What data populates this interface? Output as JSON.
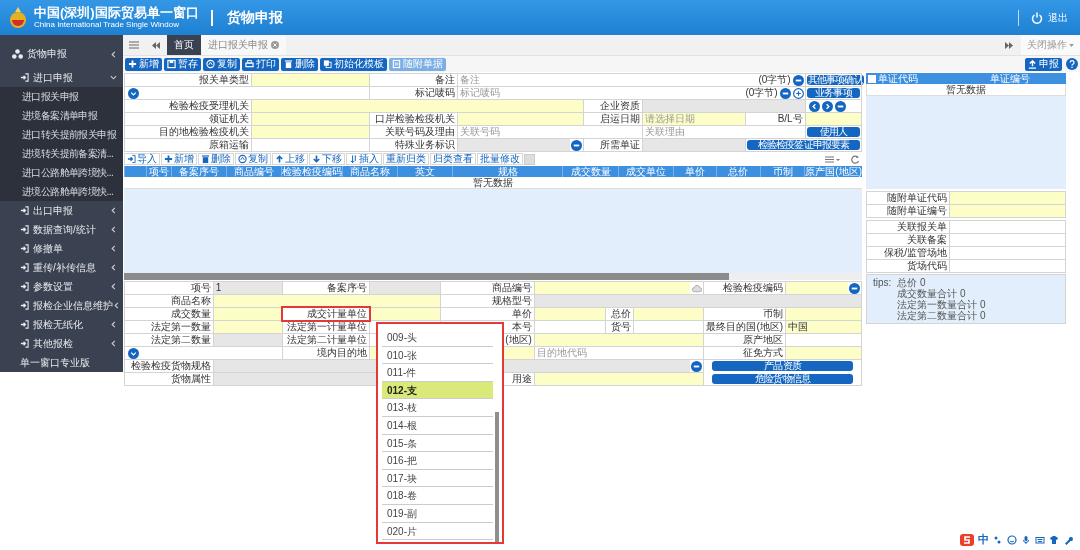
{
  "header": {
    "title": "中国(深圳)国际贸易单一窗口",
    "subtitle": "China International Trade Single Window",
    "section": "货物申报",
    "logout": "退出"
  },
  "sidebar": {
    "items": [
      {
        "label": "货物申报",
        "children": [
          {
            "label": "进口申报",
            "expanded": true,
            "children": [
              {
                "label": "进口报关申报"
              },
              {
                "label": "进境备案清单申报"
              },
              {
                "label": "进口转关提前报关申报"
              },
              {
                "label": "进境转关提前备案清..."
              },
              {
                "label": "进口公路舱单跨境快..."
              },
              {
                "label": "进境公路舱单跨境快..."
              }
            ]
          },
          {
            "label": "出口申报",
            "expanded": false
          },
          {
            "label": "数据查询/统计",
            "expanded": false
          },
          {
            "label": "修撤单",
            "expanded": false
          },
          {
            "label": "重传/补传信息",
            "expanded": false
          },
          {
            "label": "参数设置",
            "expanded": false
          },
          {
            "label": "报检企业信息维护",
            "expanded": false
          },
          {
            "label": "报检无纸化",
            "expanded": false
          },
          {
            "label": "其他报检",
            "expanded": false
          }
        ]
      },
      {
        "label": "单一窗口专业版"
      }
    ]
  },
  "tabs": [
    {
      "label": "首页",
      "selected": true,
      "closable": false
    },
    {
      "label": "进口报关申报",
      "selected": false,
      "closable": true
    }
  ],
  "close_menu": "关闭操作",
  "toolbar": {
    "buttons": [
      {
        "label": "新增",
        "disabled": false
      },
      {
        "label": "暂存",
        "disabled": false
      },
      {
        "label": "复制",
        "disabled": false
      },
      {
        "label": "打印",
        "disabled": false
      },
      {
        "label": "删除",
        "disabled": false
      },
      {
        "label": "初始化模板",
        "disabled": false
      },
      {
        "label": "随附单据",
        "disabled": true
      }
    ],
    "submit": "申报"
  },
  "top_form": {
    "rows": [
      [
        {
          "kind": "label",
          "text": "报关单类型"
        },
        {
          "kind": "required_field"
        },
        {
          "kind": "label",
          "text": "备注"
        },
        {
          "kind": "field",
          "placeholder": "备注",
          "suffix": "(0字节)",
          "controls": [
            {
              "kind": "remove"
            }
          ]
        },
        "",
        "",
        "",
        {
          "kind": "button",
          "text": "其他事项确认"
        }
      ],
      [
        {
          "kind": "controls",
          "controls": [
            {
              "kind": "expand"
            }
          ]
        },
        "",
        {
          "kind": "label",
          "text": "标记唛码"
        },
        {
          "kind": "field",
          "placeholder": "标记唛码",
          "suffix": "(0字节)",
          "controls": [
            {
              "kind": "remove"
            },
            {
              "kind": "add"
            }
          ]
        },
        "",
        "",
        "",
        {
          "kind": "button",
          "text": "业务事项"
        }
      ],
      [
        {
          "kind": "label",
          "text": "检验检疫受理机关"
        },
        {
          "kind": "required_field"
        },
        "",
        "",
        {
          "kind": "label",
          "text": "企业资质"
        },
        {
          "kind": "readonly_field"
        },
        "",
        {
          "kind": "controls",
          "controls": [
            {
              "kind": "prev"
            },
            {
              "kind": "next"
            },
            {
              "kind": "remove"
            }
          ]
        }
      ],
      [
        {
          "kind": "label",
          "text": "领证机关"
        },
        {
          "kind": "required_field"
        },
        {
          "kind": "label",
          "text": "口岸检验检疫机关"
        },
        {
          "kind": "required_field"
        },
        {
          "kind": "label",
          "text": "启运日期"
        },
        {
          "kind": "required_field",
          "placeholder": "请选择日期"
        },
        {
          "kind": "label",
          "text": "B/L号"
        },
        {
          "kind": "required_field"
        }
      ],
      [
        {
          "kind": "label",
          "text": "目的地检验检疫机关"
        },
        {
          "kind": "required_field"
        },
        {
          "kind": "label",
          "text": "关联号码及理由"
        },
        {
          "kind": "field",
          "placeholder": "关联号码"
        },
        "",
        {
          "kind": "field",
          "placeholder": "关联理由"
        },
        "",
        {
          "kind": "button",
          "text": "使用人"
        }
      ],
      [
        {
          "kind": "label",
          "text": "原箱运输"
        },
        {
          "kind": "field"
        },
        {
          "kind": "label",
          "text": "特殊业务标识"
        },
        {
          "kind": "readonly_field",
          "controls": [
            {
              "kind": "remove"
            }
          ]
        },
        {
          "kind": "label",
          "text": "所需单证"
        },
        {
          "kind": "readonly_field"
        },
        {
          "kind": "button",
          "text": "检验检疫签证申报要素"
        },
        ""
      ]
    ]
  },
  "goods_table": {
    "toolbar": [
      {
        "label": "导入"
      },
      {
        "label": "新增"
      },
      {
        "label": "删除"
      },
      {
        "label": "复制"
      },
      {
        "label": "上移"
      },
      {
        "label": "下移"
      },
      {
        "label": "插入"
      },
      {
        "label": "重新归类"
      },
      {
        "label": "归类查看"
      },
      {
        "label": "批量修改"
      }
    ],
    "columns": [
      "项号",
      "备案序号",
      "商品编号",
      "检验检疫编码",
      "商品名称",
      "英文",
      "规格",
      "成交数量",
      "成交单位",
      "单价",
      "总价",
      "币制",
      "原产国(地区)"
    ],
    "empty": "暂无数据"
  },
  "docs_panel": {
    "all_checked": false,
    "columns": [
      "单证代码",
      "单证编号"
    ],
    "empty": "暂无数据",
    "fields": [
      [
        {
          "label": "随附单证代码",
          "kind": "required_field"
        },
        {
          "label": "随附单证编号",
          "kind": "required_field"
        }
      ],
      [
        {
          "label": "关联报关单",
          "kind": "field"
        },
        {
          "label": "关联备案",
          "kind": "field"
        },
        {
          "label": "保税/监管场地",
          "kind": "field"
        },
        {
          "label": "货场代码",
          "kind": "field"
        }
      ]
    ],
    "tips": {
      "label": "tips:",
      "lines": [
        "总价 0",
        "成交数量合计 0",
        "法定第一数量合计 0",
        "法定第二数量合计 0"
      ]
    }
  },
  "goods_form": {
    "rows": [
      [
        {
          "kind": "label",
          "text": "项号"
        },
        {
          "kind": "readonly_field",
          "value": "1"
        },
        {
          "kind": "label",
          "text": "备案序号"
        },
        {
          "kind": "readonly_field"
        },
        {
          "kind": "label",
          "text": "商品编号"
        },
        {
          "kind": "required_field",
          "controls": [
            {
              "kind": "upload"
            }
          ]
        },
        "",
        "",
        {
          "kind": "label",
          "text": "检验检疫编码"
        },
        {
          "kind": "required_field",
          "controls": [
            {
              "kind": "remove"
            }
          ]
        }
      ],
      [
        {
          "kind": "label",
          "text": "商品名称"
        },
        {
          "kind": "required_field"
        },
        "",
        "",
        {
          "kind": "label",
          "text": "规格型号"
        },
        {
          "kind": "readonly_field"
        },
        "",
        "",
        "",
        ""
      ],
      [
        {
          "kind": "label",
          "text": "成交数量"
        },
        {
          "kind": "required_field"
        },
        {
          "kind": "label",
          "text": "成交计量单位",
          "highlighted": true
        },
        {
          "kind": "required_field"
        },
        {
          "kind": "label",
          "text": "单价"
        },
        {
          "kind": "required_field"
        },
        {
          "kind": "label",
          "text": "总价"
        },
        {
          "kind": "required_field"
        },
        {
          "kind": "label",
          "text": "币制"
        },
        {
          "kind": "required_field"
        }
      ],
      [
        {
          "kind": "label",
          "text": "法定第一数量"
        },
        {
          "kind": "required_field"
        },
        {
          "kind": "label",
          "text": "法定第一计量单位"
        },
        {
          "kind": "field"
        },
        {
          "kind": "label",
          "text": "本号"
        },
        {
          "kind": "field"
        },
        {
          "kind": "label",
          "text": "货号"
        },
        {
          "kind": "field"
        },
        {
          "kind": "label",
          "text": "最终目的国(地区)"
        },
        {
          "kind": "required_field",
          "value": "中国"
        }
      ],
      [
        {
          "kind": "label",
          "text": "法定第二数量"
        },
        {
          "kind": "readonly_field"
        },
        {
          "kind": "label",
          "text": "法定第二计量单位"
        },
        {
          "kind": "field"
        },
        {
          "kind": "label",
          "text": "(地区)"
        },
        {
          "kind": "required_field"
        },
        "",
        "",
        {
          "kind": "label",
          "text": "原产地区"
        },
        {
          "kind": "field"
        }
      ],
      [
        {
          "kind": "controls",
          "controls": [
            {
              "kind": "expand"
            }
          ]
        },
        "",
        {
          "kind": "label",
          "text": "境内目的地"
        },
        {
          "kind": "required_field"
        },
        "",
        {
          "kind": "field",
          "placeholder": "目的地代码"
        },
        "",
        "",
        {
          "kind": "label",
          "text": "征免方式"
        },
        {
          "kind": "required_field"
        }
      ],
      [
        {
          "kind": "label",
          "text": "检验检疫货物规格"
        },
        {
          "kind": "readonly_field",
          "controls": [
            {
              "kind": "remove"
            }
          ]
        },
        "",
        "",
        "",
        "",
        "",
        "",
        {
          "kind": "buttons",
          "items": [
            "产品资质",
            "危险货物信息"
          ]
        },
        ""
      ],
      [
        {
          "kind": "label",
          "text": "货物属性"
        },
        {
          "kind": "readonly_field"
        },
        "",
        "",
        {
          "kind": "label",
          "text": "用途"
        },
        {
          "kind": "required_field"
        },
        "",
        "",
        "",
        ""
      ]
    ],
    "dropdown": {
      "highlighted": true,
      "items": [
        {
          "label": "009-头",
          "selected": false
        },
        {
          "label": "010-张",
          "selected": false
        },
        {
          "label": "011-件",
          "selected": false
        },
        {
          "label": "012-支",
          "selected": true
        },
        {
          "label": "013-枝",
          "selected": false
        },
        {
          "label": "014-根",
          "selected": false
        },
        {
          "label": "015-条",
          "selected": false
        },
        {
          "label": "016-把",
          "selected": false
        },
        {
          "label": "017-块",
          "selected": false
        },
        {
          "label": "018-卷",
          "selected": false
        },
        {
          "label": "019-副",
          "selected": false
        },
        {
          "label": "020-片",
          "selected": false
        }
      ]
    }
  },
  "ime_bar": {
    "mode": "中"
  }
}
